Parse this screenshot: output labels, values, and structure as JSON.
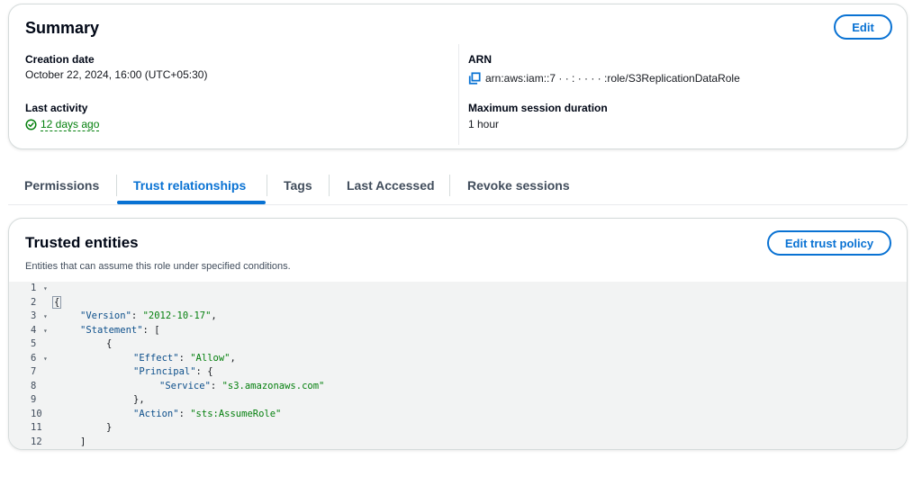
{
  "summary": {
    "title": "Summary",
    "edit_label": "Edit",
    "creation_date_label": "Creation date",
    "creation_date_value": "October 22, 2024, 16:00 (UTC+05:30)",
    "last_activity_label": "Last activity",
    "last_activity_value": "12 days ago",
    "arn_label": "ARN",
    "arn_value": "arn:aws:iam::7  ·  ·  :  ·  ·  ·  ·  :role/S3ReplicationDataRole",
    "max_session_label": "Maximum session duration",
    "max_session_value": "1 hour"
  },
  "tabs": [
    {
      "label": "Permissions"
    },
    {
      "label": "Trust relationships"
    },
    {
      "label": "Tags"
    },
    {
      "label": "Last Accessed"
    },
    {
      "label": "Revoke sessions"
    }
  ],
  "active_tab": "Trust relationships",
  "trusted": {
    "title": "Trusted entities",
    "description": "Entities that can assume this role under specified conditions.",
    "edit_label": "Edit trust policy"
  },
  "policy_lines": [
    {
      "num": "1",
      "fold": true
    },
    {
      "num": "2",
      "fold": false
    },
    {
      "num": "3",
      "fold": true
    },
    {
      "num": "4",
      "fold": true
    },
    {
      "num": "5",
      "fold": false
    },
    {
      "num": "6",
      "fold": true
    },
    {
      "num": "7",
      "fold": false
    },
    {
      "num": "8",
      "fold": false
    },
    {
      "num": "9",
      "fold": false
    },
    {
      "num": "10",
      "fold": false
    },
    {
      "num": "11",
      "fold": false
    },
    {
      "num": "12",
      "fold": false
    }
  ],
  "policy": {
    "version_key": "\"Version\"",
    "version_val": "\"2012-10-17\"",
    "statement_key": "\"Statement\"",
    "effect_key": "\"Effect\"",
    "effect_val": "\"Allow\"",
    "principal_key": "\"Principal\"",
    "service_key": "\"Service\"",
    "service_val": "\"s3.amazonaws.com\"",
    "action_key": "\"Action\"",
    "action_val": "\"sts:AssumeRole\""
  },
  "colors": {
    "accent": "#0972d3",
    "success": "#037f0c",
    "code_background": "#f2f3f3"
  },
  "icons": {
    "last_activity": "check-circle-icon",
    "arn": "copy-icon"
  }
}
